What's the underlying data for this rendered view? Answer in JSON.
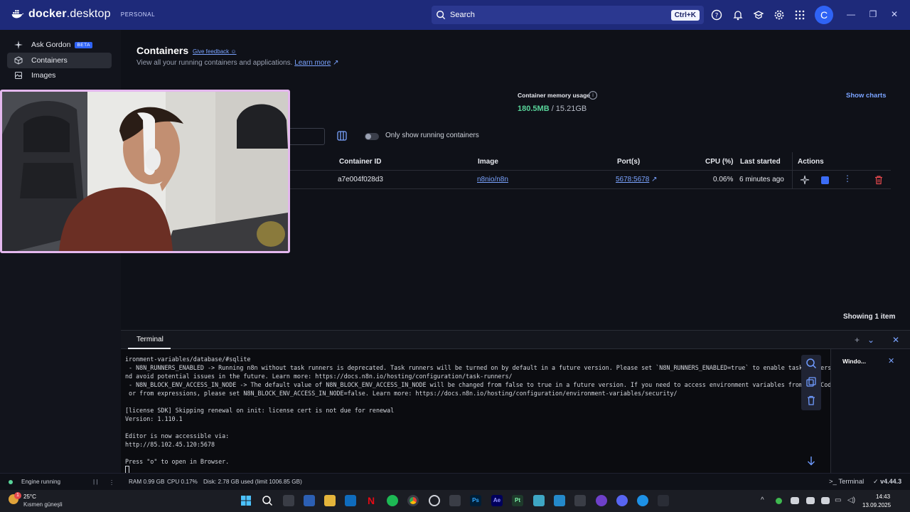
{
  "titlebar": {
    "brand_a": "docker",
    "brand_b": ".desktop",
    "plan": "PERSONAL",
    "search_label": "Search",
    "search_shortcut": "Ctrl+K",
    "avatar_letter": "C"
  },
  "sidebar": {
    "items": [
      {
        "label": "Ask Gordon",
        "badge": "BETA",
        "icon": "sparkle-icon"
      },
      {
        "label": "Containers",
        "icon": "container-icon"
      },
      {
        "label": "Images",
        "icon": "image-icon"
      }
    ]
  },
  "main": {
    "title": "Containers",
    "feedback": "Give feedback",
    "subtitle": "View all your running containers and applications.",
    "learn_more": "Learn more",
    "memory_label": "Container memory usage",
    "memory_used": "180.5MB",
    "memory_total": " / 15.21GB",
    "show_charts": "Show charts",
    "toggle_label": "Only show running containers",
    "columns": [
      "Container ID",
      "Image",
      "Port(s)",
      "CPU (%)",
      "Last started",
      "Actions"
    ],
    "rows": [
      {
        "container_id": "a7e004f028d3",
        "image": "n8nio/n8n",
        "ports": "5678:5678",
        "cpu": "0.06%",
        "last_started": "6 minutes ago"
      }
    ],
    "showing": "Showing 1 item"
  },
  "terminal": {
    "tab": "Terminal",
    "lines": [
      "ironment-variables/database/#sqlite",
      " - N8N_RUNNERS_ENABLED -> Running n8n without task runners is deprecated. Task runners will be turned on by default in a future version. Please set `N8N_RUNNERS_ENABLED=true` to enable task runners now a",
      "nd avoid potential issues in the future. Learn more: https://docs.n8n.io/hosting/configuration/task-runners/",
      " - N8N_BLOCK_ENV_ACCESS_IN_NODE -> The default value of N8N_BLOCK_ENV_ACCESS_IN_NODE will be changed from false to true in a future version. If you need to access environment variables from the Code Node",
      " or from expressions, please set N8N_BLOCK_ENV_ACCESS_IN_NODE=false. Learn more: https://docs.n8n.io/hosting/configuration/environment-variables/security/",
      "",
      "[license SDK] Skipping renewal on init: license cert is not due for renewal",
      "Version: 1.110.1",
      "",
      "Editor is now accessible via:",
      "http://85.102.45.120:5678",
      "",
      "Press \"o\" to open in Browser."
    ],
    "side_panel_title": "Windo..."
  },
  "statusbar": {
    "engine": "Engine running",
    "ram": "RAM 0.99 GB",
    "cpu": "CPU 0.17%",
    "disk": "Disk: 2.78 GB used (limit 1006.85 GB)",
    "terminal": "Terminal",
    "version": "v4.44.3"
  },
  "taskbar": {
    "weather_temp": "25°C",
    "weather_desc": "Kısmen güneşli",
    "notification_count": "1",
    "time": "14:43",
    "date": "13.09.2025",
    "ps_label": "Ps",
    "ae_label": "Ae",
    "pt_label": "Pt"
  },
  "colors": {
    "titlebar": "#1e2a7a",
    "accent": "#2f63f5",
    "link": "#7aa3ff",
    "memory_green": "#58d399",
    "danger": "#e5484d"
  }
}
